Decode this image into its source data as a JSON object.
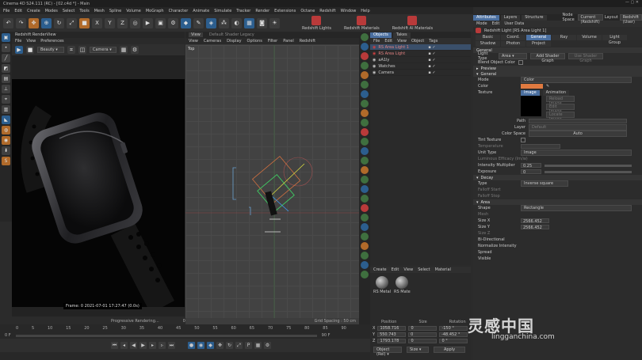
{
  "window": {
    "title": "Cinema 4D S24.111 (RC) - [02.c4d *] - Main"
  },
  "menu": [
    "File",
    "Edit",
    "Create",
    "Modes",
    "Select",
    "Tools",
    "Mesh",
    "Spline",
    "Volume",
    "MoGraph",
    "Character",
    "Animate",
    "Simulate",
    "Tracker",
    "Render",
    "Extensions",
    "Octane",
    "Redshift",
    "Window",
    "Help"
  ],
  "redshift_toolbar": {
    "lights": "Redshift Lights",
    "materials": "Redshift Materials",
    "ai_materials": "Redshift AI Materials"
  },
  "render_view": {
    "title": "Redshift RenderView",
    "menu": [
      "File",
      "View",
      "Preferences"
    ],
    "beauty_select": "Beauty",
    "camera_select": "Camera",
    "frame_label": "Frame: 0  2021-07-01 17:27:47 (0.0s)",
    "status": "Progressive Rendering...",
    "zoom": "0%"
  },
  "viewport": {
    "label": "Default Shader Legacy",
    "menu": [
      "View",
      "Cameras",
      "Display",
      "Options",
      "Filter",
      "Panel",
      "Redshift"
    ],
    "view_name": "Top",
    "grid_spacing": "Grid Spacing : 50 cm"
  },
  "object_manager": {
    "tabs": [
      "Objects",
      "Takes"
    ],
    "menu": [
      "File",
      "Edit",
      "View",
      "Object",
      "Tags"
    ],
    "objects": [
      {
        "name": "RS Area Light 1",
        "selected": true
      },
      {
        "name": "RS Area Light",
        "selected": false
      },
      {
        "name": "aA1ly",
        "selected": false
      },
      {
        "name": "Watches",
        "selected": false
      },
      {
        "name": "Camera",
        "selected": false
      }
    ]
  },
  "material_manager": {
    "menu": [
      "Create",
      "Edit",
      "View",
      "Select",
      "Material"
    ],
    "materials": [
      "RS Metal",
      "RS Mate"
    ]
  },
  "coordinates": {
    "headers": [
      "Position",
      "Size",
      "Rotation"
    ],
    "rows": [
      {
        "axis": "X",
        "pos": "1058.716",
        "size": "0",
        "rot": "-150 °"
      },
      {
        "axis": "Y",
        "pos": "550.743",
        "size": "0",
        "rot": "-48.452 °"
      },
      {
        "axis": "Z",
        "pos": "1793.178",
        "size": "0",
        "rot": "0 °"
      }
    ],
    "mode": "Object (Rel)",
    "size_mode": "Size",
    "apply": "Apply"
  },
  "attributes": {
    "tabs_top": [
      "Attributes",
      "Layers",
      "Structure"
    ],
    "node_space_label": "Node Space",
    "node_space": "Current (Redshift)",
    "layout_label": "Layout",
    "layout": "Redshift (User)",
    "menu": [
      "Mode",
      "Edit",
      "User Data"
    ],
    "object_title": "Redshift Light [RS Area Light 1]",
    "tabs": [
      "Basic",
      "Coord.",
      "General",
      "Ray",
      "Volume",
      "Light Group",
      "Shadow",
      "Photon",
      "Project"
    ],
    "active_tab": "General",
    "general": "General",
    "light_type_label": "Light Type",
    "light_type": "Area",
    "add_shader_graph": "Add Shader Graph",
    "use_shader_graph": "Use Shader Graph",
    "blend_object_color": "Blend Object Color",
    "preview": "Preview",
    "general_sec": "General",
    "mode_label": "Mode",
    "mode": "Color",
    "color_label": "Color",
    "color_value": "#e07a40",
    "texture_label": "Texture",
    "image_btn": "Image",
    "animation_btn": "Animation",
    "reload_image": "Reload Image...",
    "edit_image": "Edit Image...",
    "locate_image": "Locate Image...",
    "path_label": "Path",
    "layer_label": "Layer",
    "layer_value": "Default",
    "color_space_label": "Color Space",
    "color_space": "Auto",
    "tint_texture": "Tint Texture",
    "temperature": "Temperature",
    "unit_type_label": "Unit Type",
    "unit_type": "Image",
    "luminous_efficacy": "Luminous Efficacy (lm/w)",
    "intensity_label": "Intensity Multiplier",
    "intensity": "0.25",
    "exposure_label": "Exposure",
    "exposure": "0",
    "decay": "Decay",
    "decay_type_label": "Type",
    "decay_type": "Inverse square",
    "falloff_start": "Falloff Start",
    "falloff_stop": "Falloff Stop",
    "area": "Area",
    "shape_label": "Shape",
    "shape": "Rectangle",
    "mesh_label": "Mesh",
    "size_x_label": "Size X",
    "size_x": "2566.452",
    "size_y_label": "Size Y",
    "size_y": "2566.452",
    "size_z_label": "Size Z",
    "bidirectional": "Bi-Directional",
    "normalize": "Normalize Intensity",
    "spread": "Spread",
    "visible": "Visible"
  },
  "timeline": {
    "ticks": [
      "0",
      "5",
      "10",
      "15",
      "20",
      "25",
      "30",
      "35",
      "40",
      "45",
      "50",
      "55",
      "60",
      "65",
      "70",
      "75",
      "80",
      "85",
      "90"
    ],
    "start": "0 F",
    "end": "90 F",
    "current": "0 F"
  },
  "watermark": {
    "cn": "灵感中国",
    "url": "lingganchina.com"
  }
}
